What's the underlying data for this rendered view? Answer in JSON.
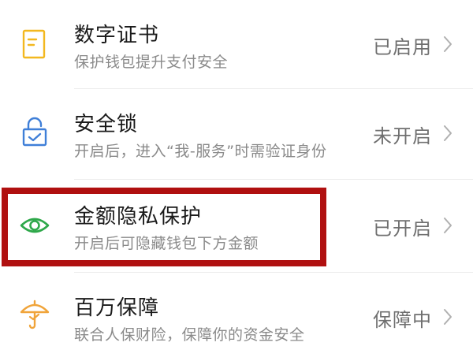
{
  "settings": {
    "items": [
      {
        "title": "数字证书",
        "subtitle": "保护钱包提升支付安全",
        "status": "已启用",
        "icon": "certificate-icon",
        "icon_color": "#f3b81f"
      },
      {
        "title": "安全锁",
        "subtitle": "开启后，进入“我-服务”时需验证身份",
        "status": "未开启",
        "icon": "lock-icon",
        "icon_color": "#3f7fd8"
      },
      {
        "title": "金额隐私保护",
        "subtitle": "开启后可隐藏钱包下方金额",
        "status": "已开启",
        "icon": "eye-icon",
        "icon_color": "#2ea84a"
      },
      {
        "title": "百万保障",
        "subtitle": "联合人保财险，保障你的资金安全",
        "status": "保障中",
        "icon": "umbrella-icon",
        "icon_color": "#f0a43a"
      }
    ],
    "highlight_color": "#b01010"
  }
}
